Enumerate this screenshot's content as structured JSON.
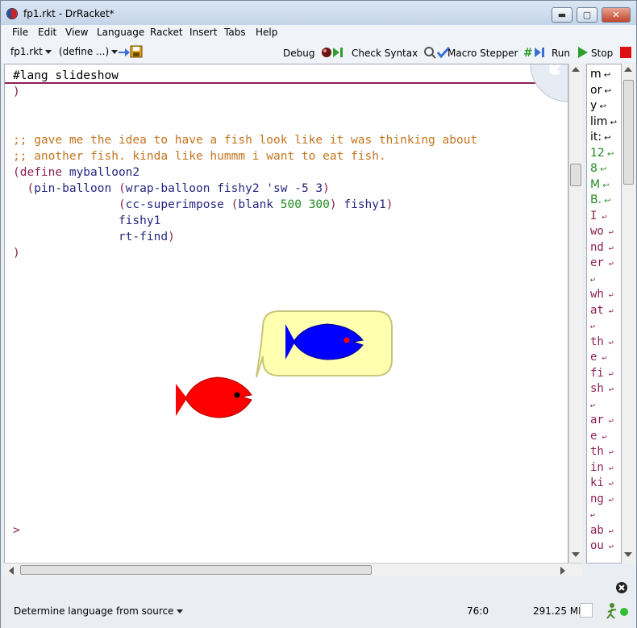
{
  "window": {
    "title": "fp1.rkt - DrRacket*",
    "controls": {
      "minimize": "▬",
      "maximize": "▢",
      "close": "✕"
    }
  },
  "menu": [
    "File",
    "Edit",
    "View",
    "Language",
    "Racket",
    "Insert",
    "Tabs",
    "Help"
  ],
  "toolbar": {
    "file_name": "fp1.rkt",
    "define_menu": "(define ...)",
    "debug_label": "Debug",
    "check_syntax_label": "Check Syntax",
    "macro_stepper_label": "Macro Stepper",
    "run_label": "Run",
    "stop_label": "Stop"
  },
  "editor": {
    "lang_line": "#lang slideshow",
    "close_paren": ")",
    "comment1": ";; gave me the idea to have a fish look like it was thinking about",
    "comment2": ";; another fish. kinda like hummm i want to eat fish.",
    "define_kw": "(define",
    "define_name": " myballoon2",
    "pin_open": "(",
    "pin_name": "pin-balloon",
    "wrap_open": "(",
    "wrap_name": "wrap-balloon fishy2 'sw -5 3",
    "wrap_close": ")",
    "cc_open": "(",
    "cc_name": "cc-superimpose",
    "blank_open": "(",
    "blank_name": "blank",
    "blank_w": "500",
    "blank_h": "300",
    "blank_close": ")",
    "cc_tail": " fishy1",
    "cc_close": ")",
    "arg_fishy1": "fishy1",
    "arg_rtfind": "rt-find",
    "arg_close": ")",
    "final_paren": ")",
    "prompt": ">"
  },
  "outline": {
    "memory_lines": [
      "m",
      "or",
      "y",
      "lim",
      "it:",
      "12",
      "8",
      "M",
      "B."
    ],
    "message_lines": [
      "I",
      "wo",
      "nd",
      "er",
      "",
      "wh",
      "at",
      "",
      "th",
      "e",
      "fi",
      "sh",
      "",
      "ar",
      "e",
      "th",
      "in",
      "ki",
      "ng",
      "",
      "ab",
      "ou"
    ]
  },
  "status": {
    "language_selector": "Determine language from source",
    "position": "76:0",
    "memory": "291.25 MB"
  },
  "colors": {
    "fish_red": "#ff0000",
    "fish_blue": "#0000ff",
    "balloon_fill": "#ffffb0",
    "comment": "#c2741f",
    "keyword": "#262680",
    "number": "#228b22",
    "paren": "#8b2252"
  }
}
